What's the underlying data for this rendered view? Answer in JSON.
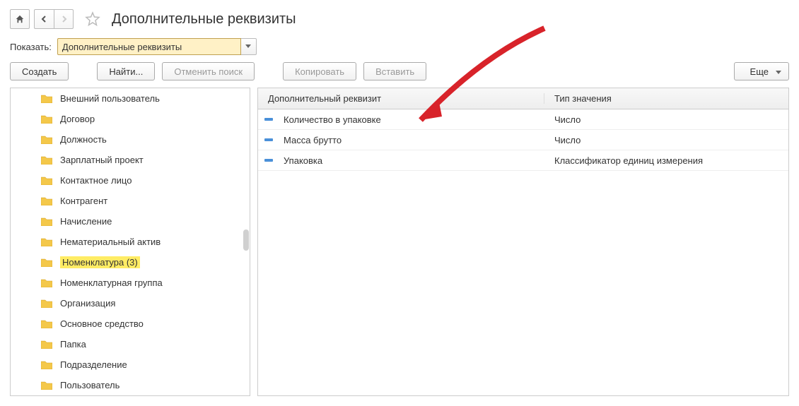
{
  "title": "Дополнительные реквизиты",
  "filter": {
    "label": "Показать:",
    "value": "Дополнительные реквизиты"
  },
  "toolbar": {
    "create": "Создать",
    "find": "Найти...",
    "cancel_search": "Отменить поиск",
    "copy": "Копировать",
    "paste": "Вставить",
    "more": "Еще"
  },
  "tree": [
    {
      "label": "Внешний пользователь"
    },
    {
      "label": "Договор"
    },
    {
      "label": "Должность"
    },
    {
      "label": "Зарплатный проект"
    },
    {
      "label": "Контактное лицо"
    },
    {
      "label": "Контрагент"
    },
    {
      "label": "Начисление"
    },
    {
      "label": "Нематериальный актив"
    },
    {
      "label": "Номенклатура (3)",
      "highlight": true
    },
    {
      "label": "Номенклатурная группа"
    },
    {
      "label": "Организация"
    },
    {
      "label": "Основное средство"
    },
    {
      "label": "Папка"
    },
    {
      "label": "Подразделение"
    },
    {
      "label": "Пользователь"
    }
  ],
  "table": {
    "head": {
      "c1": "Дополнительный реквизит",
      "c2": "Тип значения"
    },
    "rows": [
      {
        "name": "Количество в упаковке",
        "type": "Число"
      },
      {
        "name": "Масса брутто",
        "type": "Число"
      },
      {
        "name": "Упаковка",
        "type": "Классификатор единиц измерения"
      }
    ]
  }
}
